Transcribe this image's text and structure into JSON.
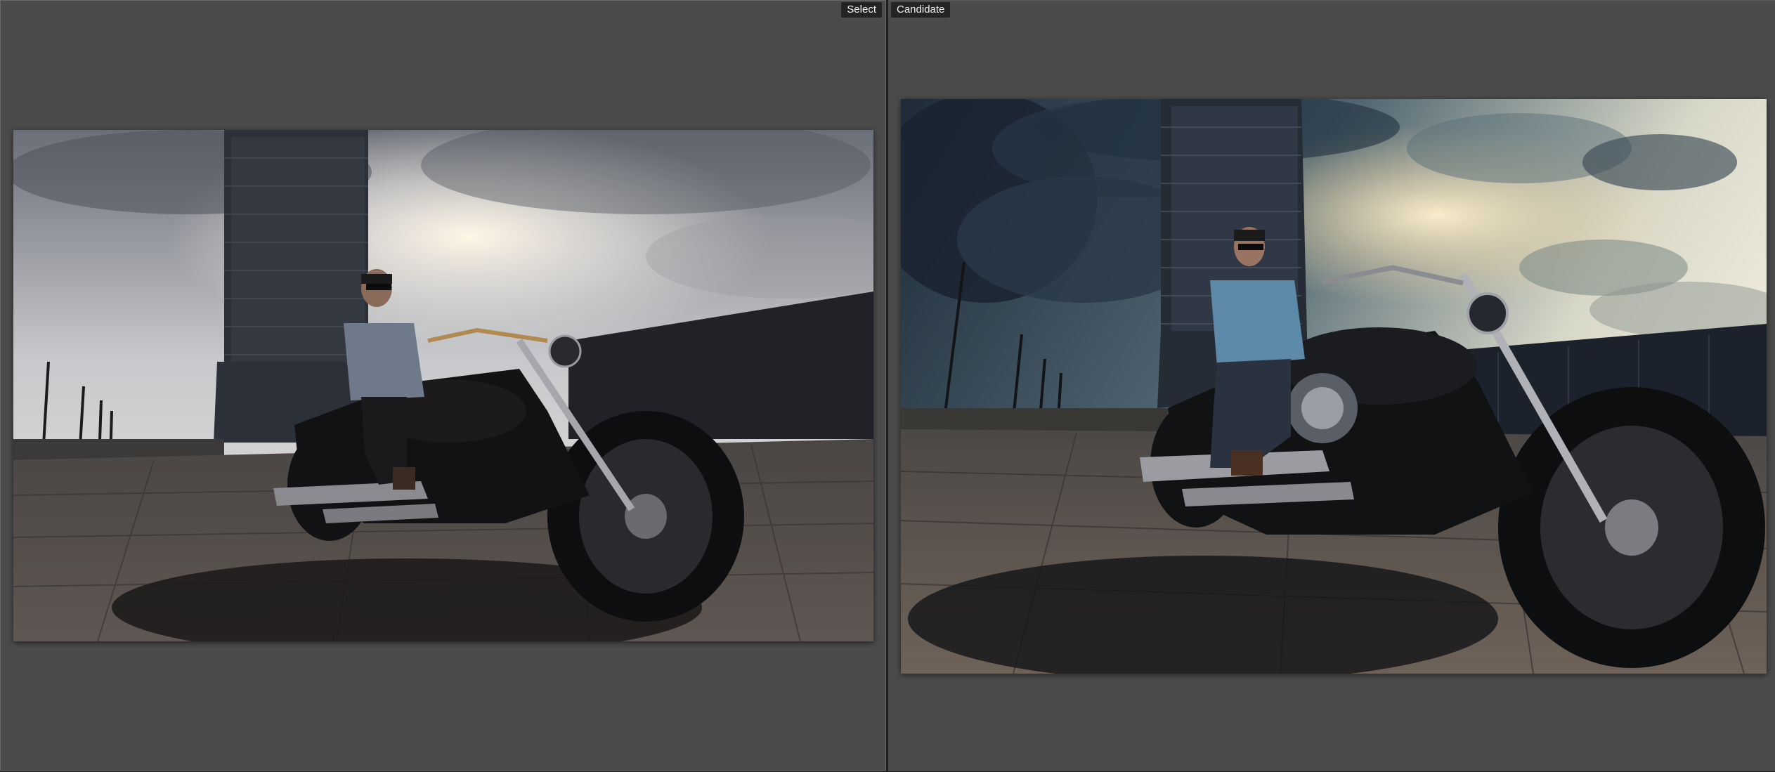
{
  "window": {
    "mode": "compare-view"
  },
  "panes": [
    {
      "id": "select",
      "label": "Select",
      "photo_icon": "photo-thumbnail-icon",
      "tone": "original-muted"
    },
    {
      "id": "candidate",
      "label": "Candidate",
      "photo_icon": "photo-thumbnail-icon",
      "tone": "edited-dramatic"
    }
  ],
  "colors": {
    "panel_background": "#4b4b4b",
    "label_background": "#242424",
    "label_text": "#f2f2f2",
    "divider": "#1f1f1f"
  }
}
